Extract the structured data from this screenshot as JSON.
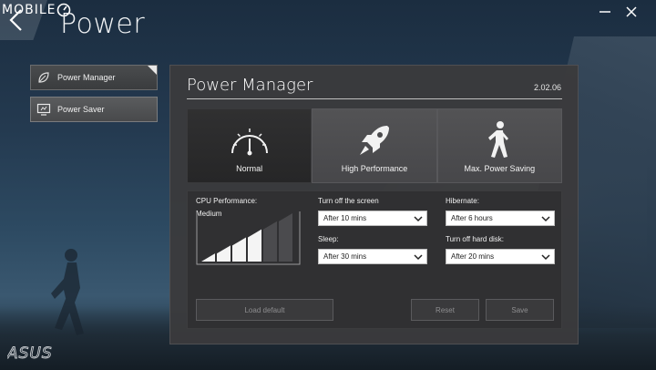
{
  "watermark": {
    "text": "MOBILE"
  },
  "header": {
    "app_title": "Power"
  },
  "sidebar": {
    "items": [
      {
        "label": "Power Manager",
        "icon": "leaf-icon",
        "active": true
      },
      {
        "label": "Power Saver",
        "icon": "monitor-icon",
        "active": false
      }
    ]
  },
  "panel": {
    "title": "Power Manager",
    "version": "2.02.06",
    "modes": [
      {
        "label": "Normal",
        "icon": "gauge-icon",
        "selected": true
      },
      {
        "label": "High Performance",
        "icon": "rocket-icon",
        "selected": false
      },
      {
        "label": "Max. Power Saving",
        "icon": "walking-person-icon",
        "selected": false
      }
    ],
    "cpu": {
      "label": "CPU Performance:",
      "value": "Medium",
      "bars_lit": 4,
      "bars_total": 6
    },
    "fields": {
      "screen_off": {
        "label": "Turn off the screen",
        "value": "After 10 mins"
      },
      "hibernate": {
        "label": "Hibernate:",
        "value": "After 6 hours"
      },
      "sleep": {
        "label": "Sleep:",
        "value": "After 30 mins"
      },
      "hard_disk": {
        "label": "Turn off hard disk:",
        "value": "After 20 mins"
      }
    },
    "buttons": {
      "load_default": "Load default",
      "reset": "Reset",
      "save": "Save"
    }
  },
  "brand": {
    "logo_text": "ASUS"
  },
  "colors": {
    "panel_bg": "#3a3a3c",
    "selected_mode_bg": "#2a2a2b",
    "accent_white": "#ffffff"
  }
}
